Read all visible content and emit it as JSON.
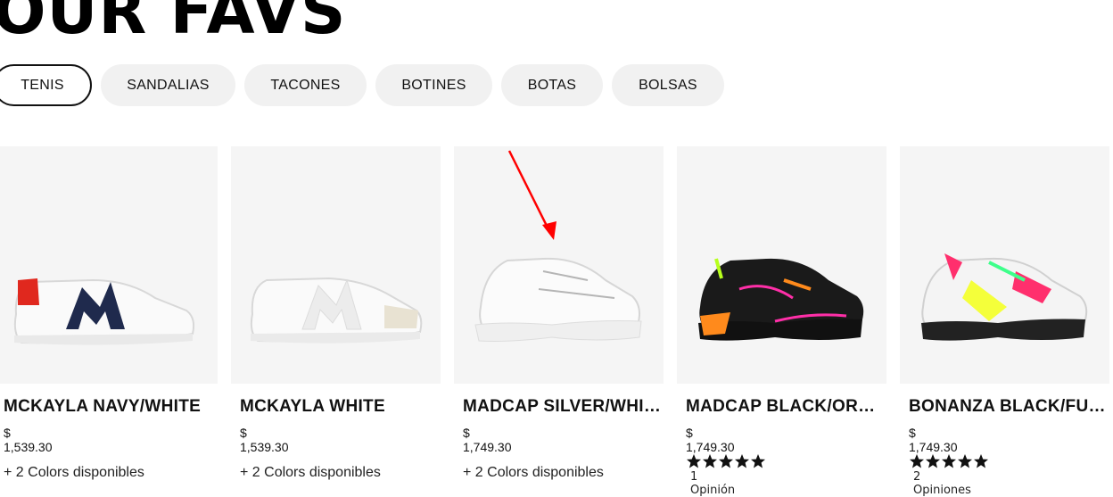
{
  "heading": "OUR FAVS",
  "tabs": [
    {
      "label": "TENIS",
      "active": true
    },
    {
      "label": "SANDALIAS",
      "active": false
    },
    {
      "label": "TACONES",
      "active": false
    },
    {
      "label": "BOTINES",
      "active": false
    },
    {
      "label": "BOTAS",
      "active": false
    },
    {
      "label": "BOLSAS",
      "active": false
    }
  ],
  "products": [
    {
      "name": "MCKAYLA NAVY/WHITE",
      "price": "$ 1,539.30",
      "colors": "+ 2 Colors disponibles"
    },
    {
      "name": "MCKAYLA WHITE",
      "price": "$ 1,539.30",
      "colors": "+ 2 Colors disponibles"
    },
    {
      "name": "MADCAP SILVER/WHITE",
      "price": "$ 1,749.30",
      "colors": "+ 2 Colors disponibles"
    },
    {
      "name": "MADCAP BLACK/ORANGE",
      "price": "$ 1,749.30",
      "rating": 5,
      "reviews": "1 Opinión"
    },
    {
      "name": "BONANZA BLACK/FUCHSIA",
      "price": "$ 1,749.30",
      "rating": 5,
      "reviews": "2 Opiniones"
    }
  ],
  "colors": {
    "active_border": "#111111",
    "tab_bg": "#f1f1f1",
    "image_bg": "#f5f5f5",
    "annotation_arrow": "#ff0000"
  }
}
